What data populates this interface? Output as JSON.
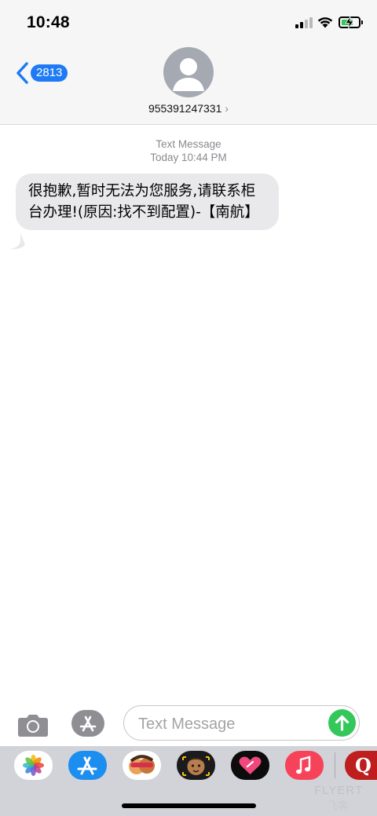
{
  "status_bar": {
    "time": "10:48"
  },
  "header": {
    "back_count": "2813",
    "contact_number": "955391247331",
    "chevron": "›"
  },
  "thread": {
    "meta_type": "Text Message",
    "meta_time": "Today 10:44 PM",
    "messages": [
      {
        "direction": "incoming",
        "text": "很抱歉,暂时无法为您服务,请联系柜台办理!(原因:找不到配置)-【南航】"
      }
    ]
  },
  "compose": {
    "placeholder": "Text Message"
  },
  "app_drawer": {
    "apps": [
      "photos-icon",
      "app-store-icon",
      "memoji-stickers-icon",
      "animoji-icon",
      "digital-touch-icon",
      "music-icon",
      "q-app-icon"
    ]
  },
  "watermark": {
    "line1": "FLYERT",
    "line2": "飞客"
  },
  "colors": {
    "accent": "#1e7bf5",
    "send": "#34c759",
    "bubble": "#e9e9eb"
  }
}
